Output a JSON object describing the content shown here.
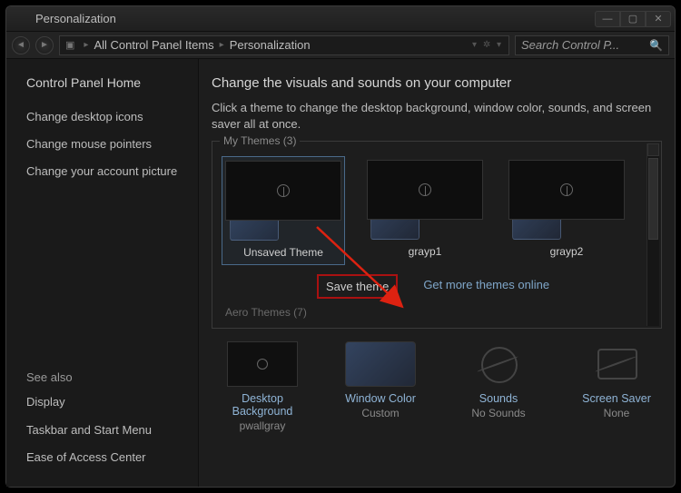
{
  "window": {
    "title": "Personalization"
  },
  "nav": {
    "crumb1": "All Control Panel Items",
    "crumb2": "Personalization"
  },
  "search": {
    "placeholder": "Search Control P..."
  },
  "sidebar": {
    "home": "Control Panel Home",
    "links": [
      "Change desktop icons",
      "Change mouse pointers",
      "Change your account picture"
    ],
    "see_also_header": "See also",
    "see_also": [
      "Display",
      "Taskbar and Start Menu",
      "Ease of Access Center"
    ]
  },
  "main": {
    "heading": "Change the visuals and sounds on your computer",
    "sub": "Click a theme to change the desktop background, window color, sounds, and screen saver all at once.",
    "my_themes_legend": "My Themes (3)",
    "themes": [
      {
        "name": "Unsaved Theme"
      },
      {
        "name": "grayp1"
      },
      {
        "name": "grayp2"
      }
    ],
    "actions": {
      "save": "Save theme",
      "more": "Get more themes online"
    },
    "aero_legend": "Aero Themes (7)",
    "settings": {
      "bg": {
        "label": "Desktop Background",
        "value": "pwallgray"
      },
      "wc": {
        "label": "Window Color",
        "value": "Custom"
      },
      "snd": {
        "label": "Sounds",
        "value": "No Sounds"
      },
      "ss": {
        "label": "Screen Saver",
        "value": "None"
      }
    }
  }
}
